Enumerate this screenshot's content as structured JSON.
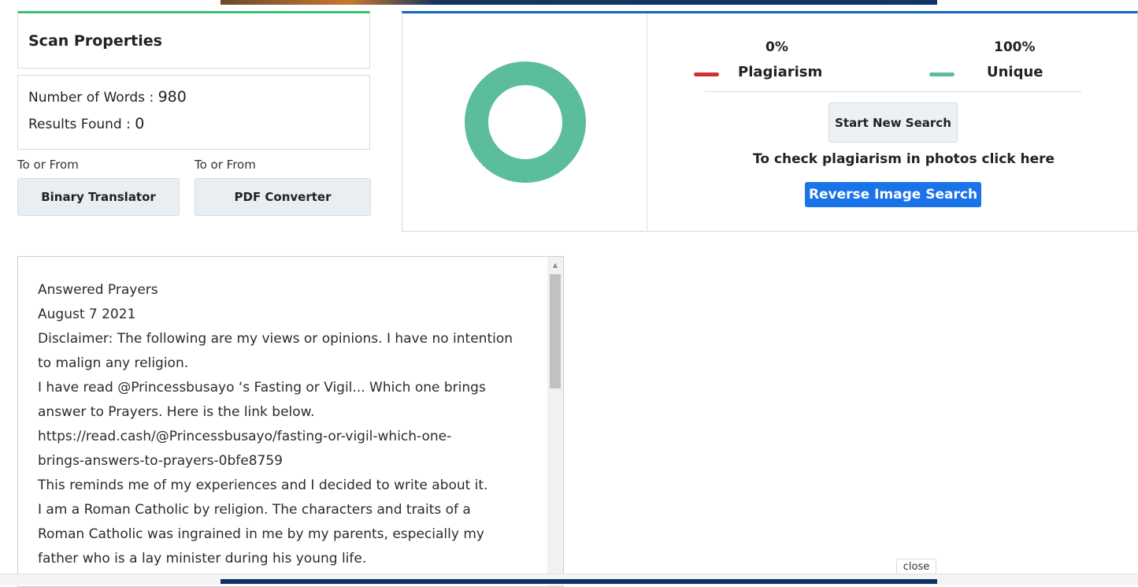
{
  "scan": {
    "title": "Scan Properties",
    "words_label": "Number of Words : ",
    "words_value": "980",
    "results_label": "Results Found : ",
    "results_value": "0"
  },
  "tools": {
    "left_caption": "To or From",
    "left_button": "Binary Translator",
    "right_caption": "To or From",
    "right_button": "PDF Converter"
  },
  "result": {
    "plagiarism_pct": "0%",
    "plagiarism_label": "Plagiarism",
    "unique_pct": "100%",
    "unique_label": "Unique",
    "plagiarism_fraction": 0,
    "unique_fraction": 1,
    "colors": {
      "plagiarism": "#d32f2f",
      "unique": "#5bbd9c"
    },
    "new_search_label": "Start New Search",
    "photo_prompt": "To check plagiarism in photos click here",
    "reverse_label": "Reverse Image Search"
  },
  "document": {
    "lines": [
      "Answered Prayers",
      "August 7 2021",
      "Disclaimer: The following are my views or opinions. I have no intention",
      "to malign any religion.",
      "I have read @Princessbusayo ‘s Fasting or Vigil... Which one brings",
      "answer to Prayers. Here is the link below.",
      "https://read.cash/@Princessbusayo/fasting-or-vigil-which-one-",
      "brings-answers-to-prayers-0bfe8759",
      "This reminds me of my experiences and I decided to write about it.",
      "I am a Roman Catholic by religion. The characters and traits of a",
      "Roman Catholic was ingrained in me by my parents, especially my",
      "father who is a lay minister during his young life."
    ]
  },
  "footer": {
    "close_label": "close"
  }
}
